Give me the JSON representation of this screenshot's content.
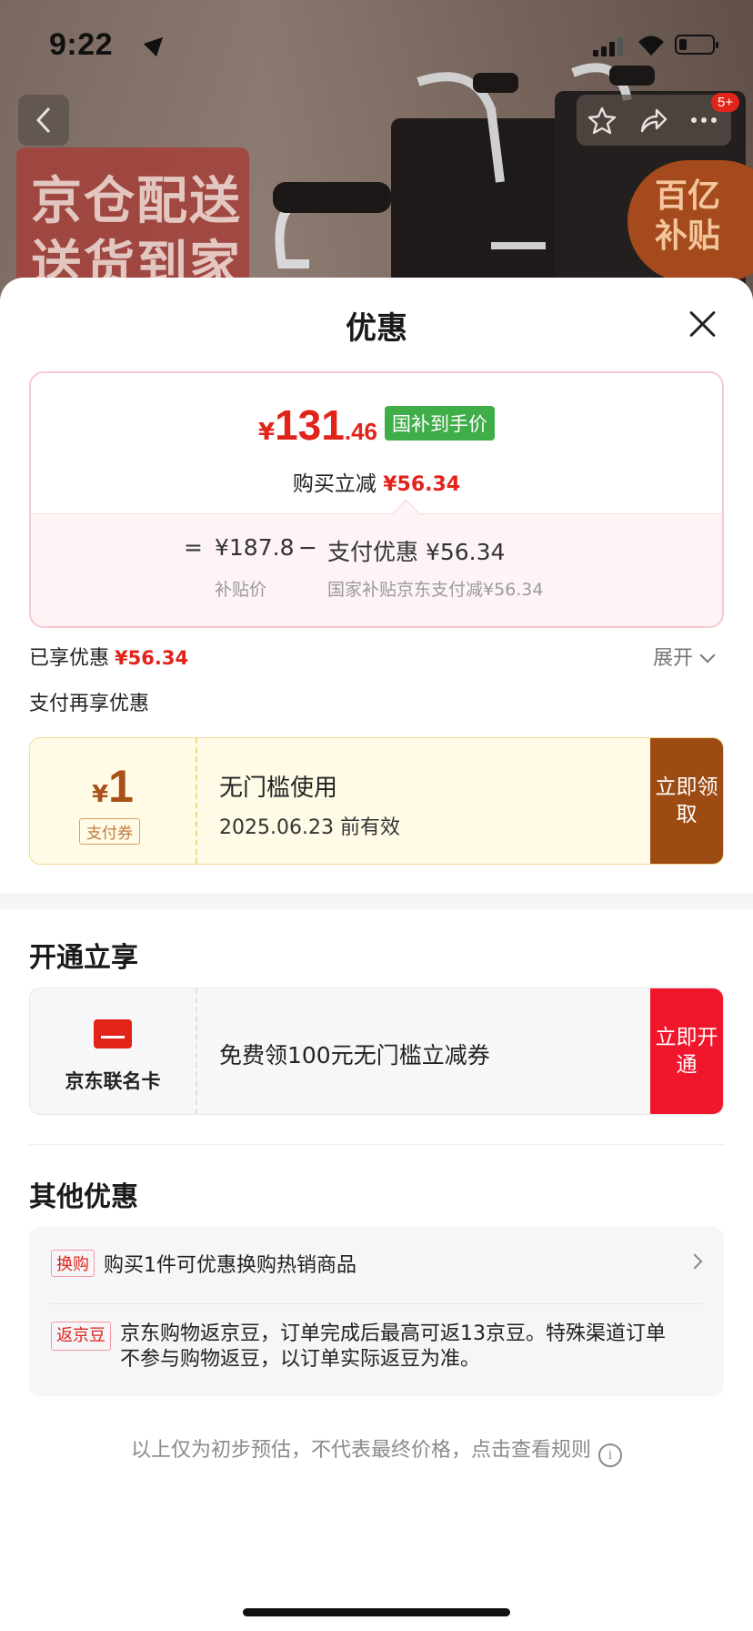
{
  "status_bar": {
    "time": "9:22"
  },
  "background": {
    "promo_line1": "京仓配送",
    "promo_line2": "送货到家",
    "subsidy_line1": "百亿",
    "subsidy_line2": "补贴",
    "badge": "5+"
  },
  "sheet": {
    "title": "优惠",
    "price": {
      "currency": "¥",
      "integer": "131",
      "decimal": ".46",
      "tag": "国补到手价",
      "reduce_label": "购买立减",
      "reduce_amount": "¥56.34",
      "equals": "=",
      "subsidy_price": "¥187.8",
      "minus": "−",
      "pay_discount": "支付优惠 ¥56.34",
      "subsidy_price_label": "补贴价",
      "pay_discount_label": "国家补贴京东支付减¥56.34"
    },
    "enjoyed": {
      "label": "已享优惠",
      "amount": "¥56.34",
      "expand": "展开"
    },
    "pay_more_title": "支付再享优惠",
    "coupon": {
      "currency": "¥",
      "value": "1",
      "type": "支付券",
      "title": "无门槛使用",
      "date": "2025.06.23 前有效",
      "action": "立即领取"
    },
    "open_title": "开通立享",
    "card": {
      "name": "京东联名卡",
      "desc": "免费领100元无门槛立减券",
      "action": "立即开通"
    },
    "other_title": "其他优惠",
    "other": {
      "tag1": "换购",
      "text1": "购买1件可优惠换购热销商品",
      "tag2": "返京豆",
      "text2": "京东购物返京豆，订单完成后最高可返13京豆。特殊渠道订单不参与购物返豆，以订单实际返豆为准。"
    },
    "footer_note": "以上仅为初步预估，不代表最终价格，点击查看规则",
    "info_icon_glyph": "i"
  },
  "colors": {
    "accent_red": "#e2231a",
    "coupon_brown": "#9c4b12",
    "card_red": "#f0162c",
    "tag_green": "#3fae49"
  },
  "icons": [
    "back-icon",
    "star-icon",
    "share-icon",
    "more-icon",
    "close-icon",
    "card-icon",
    "info-icon",
    "chevron-down-icon",
    "chevron-right-icon"
  ]
}
